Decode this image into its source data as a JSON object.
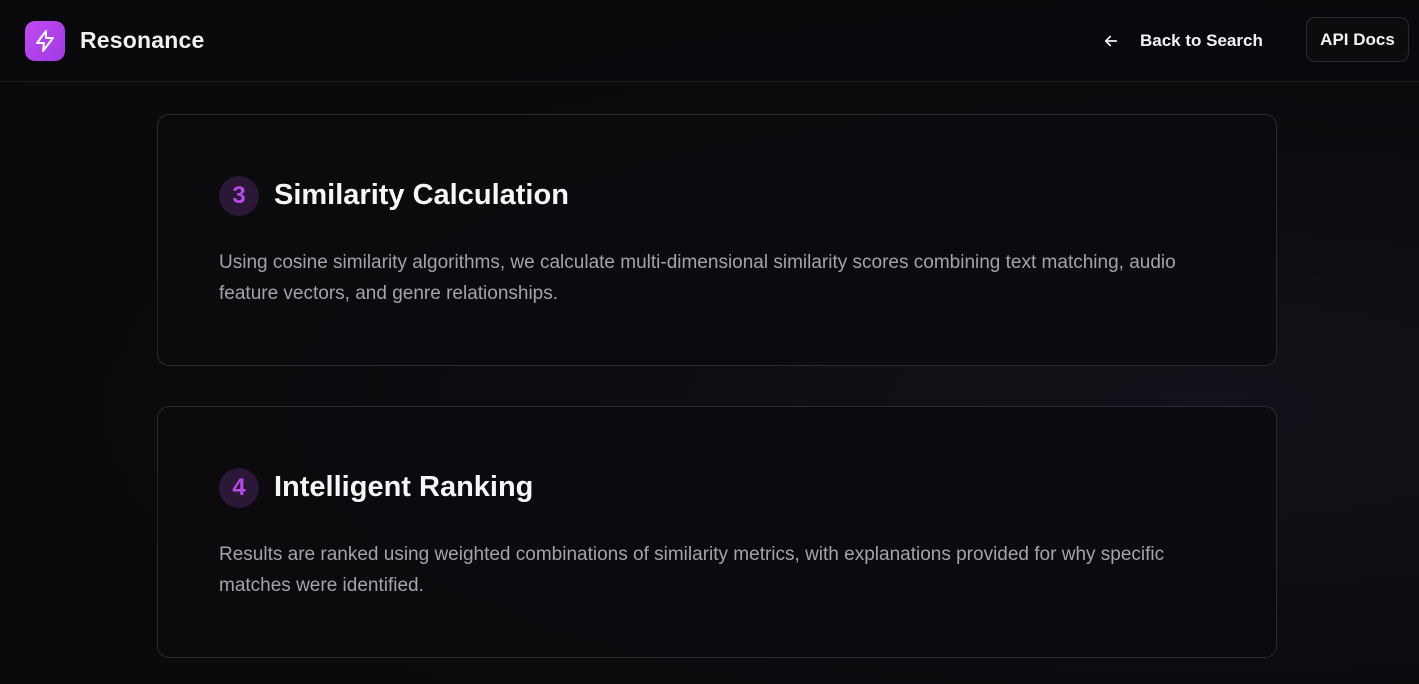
{
  "app": {
    "name": "Resonance"
  },
  "nav": {
    "back_label": "Back to Search",
    "api_docs_label": "API Docs"
  },
  "steps": [
    {
      "number": "3",
      "title": "Similarity Calculation",
      "description": "Using cosine similarity algorithms, we calculate multi-dimensional similarity scores combining text matching, audio feature vectors, and genre relationships."
    },
    {
      "number": "4",
      "title": "Intelligent Ranking",
      "description": "Results are ranked using weighted combinations of similarity metrics, with explanations provided for why specific matches were identified."
    }
  ],
  "colors": {
    "accent": "#b94ae8",
    "logo_gradient_start": "#c04cf0",
    "background": "#0a090c"
  },
  "icons": {
    "logo": "lightning-bolt-icon",
    "back": "arrow-left-icon"
  }
}
